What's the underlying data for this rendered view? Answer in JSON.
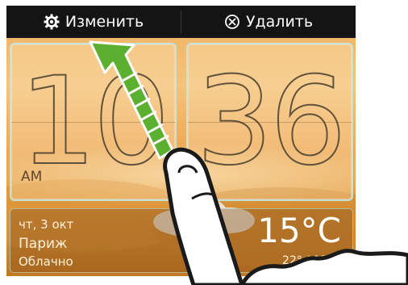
{
  "toolbar": {
    "edit": {
      "label": "Изменить",
      "icon": "gear-icon"
    },
    "delete": {
      "label": "Удалить",
      "icon": "circle-x-icon"
    }
  },
  "clock": {
    "hours": "10",
    "minutes": "36",
    "period": "AM"
  },
  "weather": {
    "date": "чт, 3 окт",
    "city": "Париж",
    "condition": "Облачно",
    "temperature": "15°C",
    "range": "22° / 15°c"
  },
  "colors": {
    "toolbar_bg": "#141414",
    "arrow_green": "#5cb030",
    "card_border": "#bee6e6"
  },
  "icons": [
    "gear-icon",
    "circle-x-icon",
    "arrow-up-left-icon",
    "hand-swipe-icon",
    "cloud-icon"
  ]
}
